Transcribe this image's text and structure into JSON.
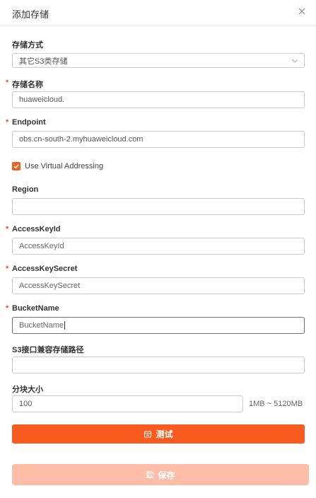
{
  "dialog": {
    "title": "添加存储"
  },
  "fields": {
    "storage_method": {
      "label": "存储方式",
      "value": "其它S3类存储"
    },
    "storage_name": {
      "label": "存储名称",
      "value": "huaweicloud."
    },
    "endpoint": {
      "label": "Endpoint",
      "value": "obs.cn-south-2.myhuaweicloud.com"
    },
    "virtual_addressing": {
      "label": "Use Virtual Addressing",
      "checked": true
    },
    "region": {
      "label": "Region",
      "value": ""
    },
    "access_key_id": {
      "label": "AccessKeyId",
      "placeholder": "AccessKeyId"
    },
    "access_key_secret": {
      "label": "AccessKeySecret",
      "placeholder": "AccessKeySecret"
    },
    "bucket_name": {
      "label": "BucketName",
      "placeholder": "BucketName"
    },
    "s3_path": {
      "label": "S3接口兼容存储路径",
      "value": ""
    },
    "chunk_size": {
      "label": "分块大小",
      "value": "100",
      "hint": "1MB ~ 5120MB"
    }
  },
  "required_mark": "*",
  "buttons": {
    "test": "测试",
    "save": "保存"
  },
  "colors": {
    "accent": "#fa5c20",
    "accent_disabled": "#fdbda7",
    "required": "#e5532b",
    "checkbox": "#ef6222"
  },
  "icons": {
    "close": "close-icon",
    "chevron": "chevron-down-icon",
    "check": "check-icon",
    "test": "test-icon",
    "save": "save-icon"
  }
}
